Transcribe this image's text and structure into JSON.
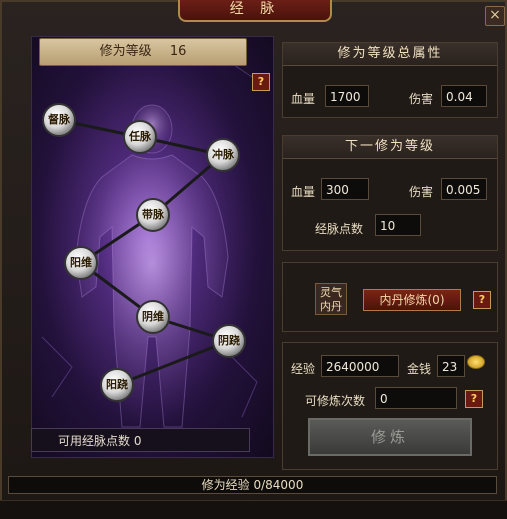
{
  "window": {
    "title": "经 脉",
    "close_glyph": "×"
  },
  "level": {
    "label": "修为等级",
    "value": "16",
    "help": "?"
  },
  "meridian_points": [
    {
      "label": "督脉"
    },
    {
      "label": "任脉"
    },
    {
      "label": "冲脉"
    },
    {
      "label": "带脉"
    },
    {
      "label": "阳维"
    },
    {
      "label": "阴维"
    },
    {
      "label": "阴跷"
    },
    {
      "label": "阳跷"
    }
  ],
  "available_points": "可用经脉点数 0",
  "total_attr": {
    "title": "修为等级总属性",
    "hp_label": "血量",
    "hp_value": "1700",
    "dmg_label": "伤害",
    "dmg_value": "0.04"
  },
  "next_level": {
    "title": "下一修为等级",
    "hp_label": "血量",
    "hp_value": "300",
    "dmg_label": "伤害",
    "dmg_value": "0.005",
    "points_label": "经脉点数",
    "points_value": "10"
  },
  "elixir": {
    "label_line1": "灵气",
    "label_line2": "内丹",
    "train_button": "内丹修炼(0)",
    "help": "?"
  },
  "cultivate": {
    "exp_label": "经验",
    "exp_value": "2640000",
    "money_label": "金钱",
    "money_value": "23",
    "times_label": "可修炼次数",
    "times_value": "0",
    "help": "?",
    "button": "修炼"
  },
  "progress": {
    "text": "修为经验 0/84000",
    "current": 0,
    "max": 84000
  },
  "colors": {
    "accent_red": "#6b1f16",
    "gold": "#f3d9a8",
    "purple_glow": "#8a54c4"
  }
}
